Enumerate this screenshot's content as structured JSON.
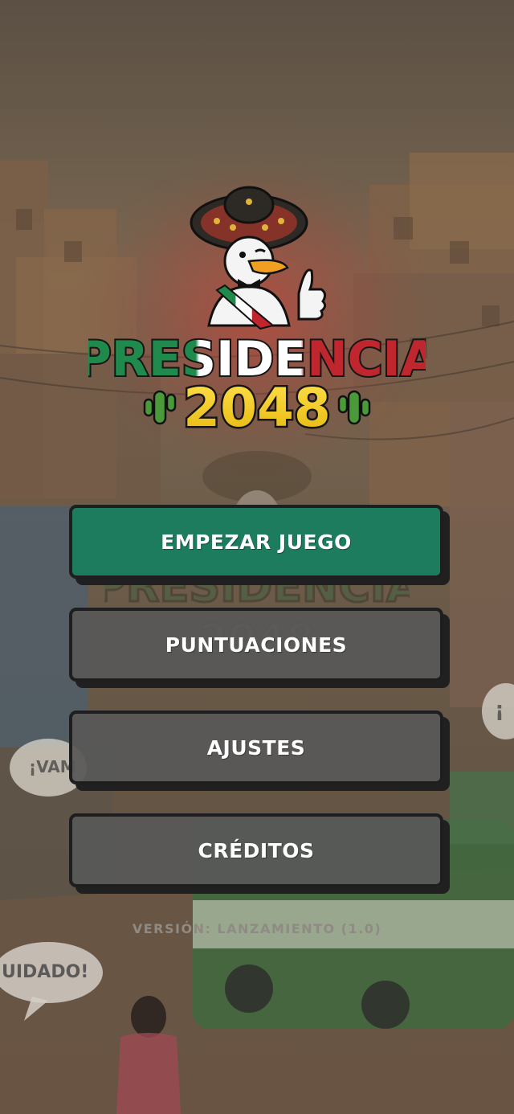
{
  "logo": {
    "title": "PRESIDENCIA",
    "year": "2048"
  },
  "menu": {
    "start": "EMPEZAR JUEGO",
    "scores": "PUNTUACIONES",
    "settings": "AJUSTES",
    "credits": "CRÉDITOS"
  },
  "version": "VERSIÓN: LANZAMIENTO (1.0)",
  "background": {
    "speech_bubble_1": "¡VAM",
    "speech_bubble_2": "UIDADO!",
    "speech_bubble_3": "¡"
  },
  "colors": {
    "primary": "#1e7c5e",
    "secondary": "#585858",
    "logo_green": "#1f8a4c",
    "logo_red": "#c0262d",
    "logo_yellow": "#f5d21c"
  }
}
